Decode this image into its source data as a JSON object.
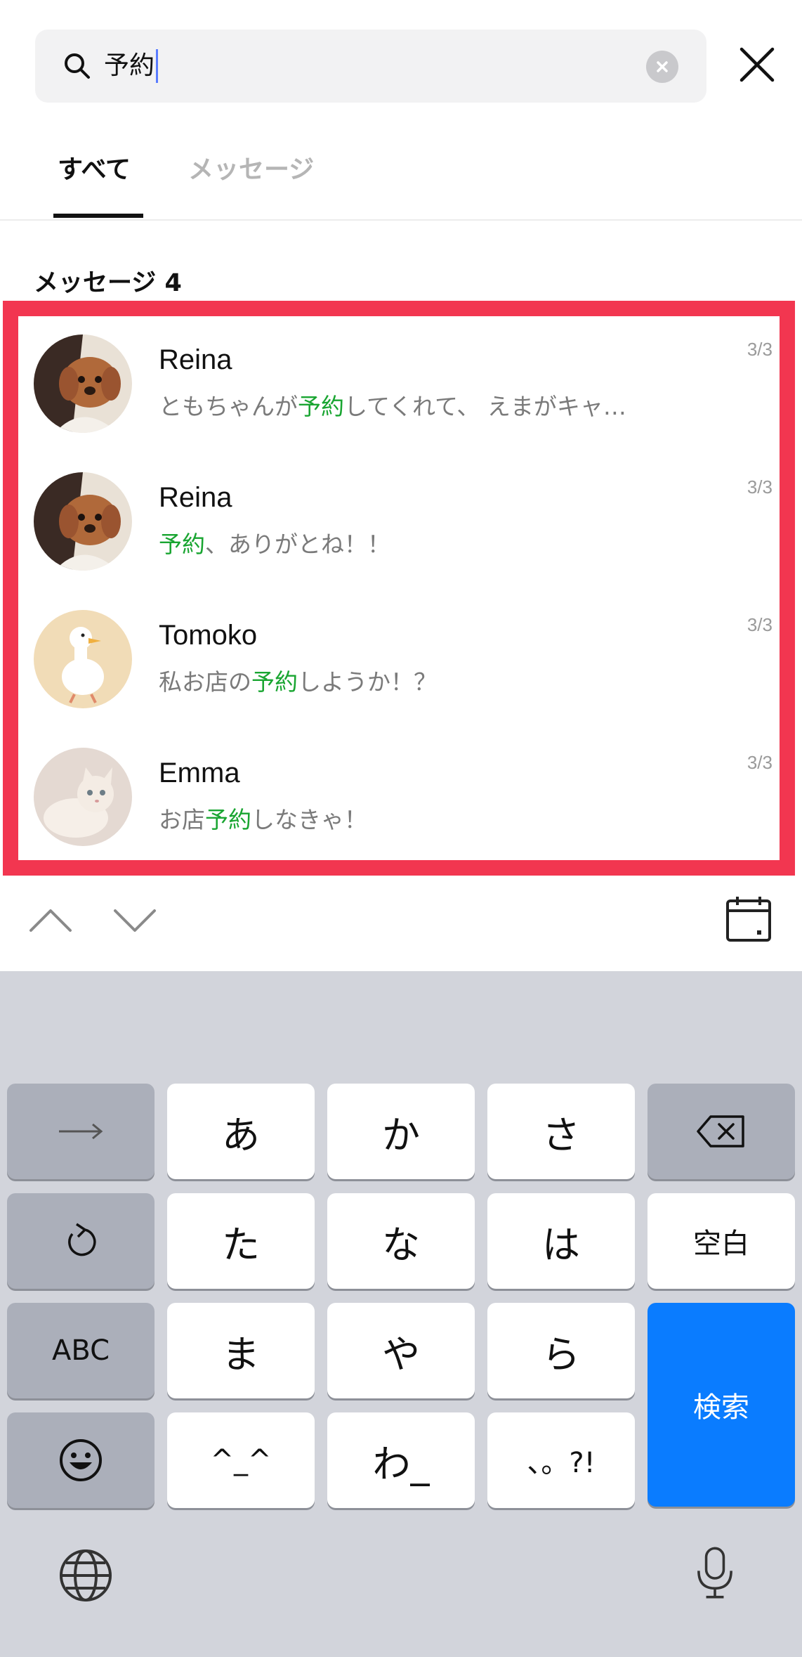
{
  "search": {
    "query": "予約",
    "clear_icon": "clear-circle-icon",
    "close_icon": "close-icon"
  },
  "tabs": [
    {
      "label": "すべて",
      "active": true
    },
    {
      "label": "メッセージ",
      "active": false
    }
  ],
  "section": {
    "title": "メッセージ 4"
  },
  "highlight_color": "#19a531",
  "results": [
    {
      "name": "Reina",
      "date": "3/3",
      "pre": "ともちゃんが",
      "hl": "予約",
      "post": "してくれて、 えまがキャ…",
      "avatar": "dog-avatar"
    },
    {
      "name": "Reina",
      "date": "3/3",
      "pre": "",
      "hl": "予約",
      "post": "、ありがとね！！",
      "avatar": "dog-avatar"
    },
    {
      "name": "Tomoko",
      "date": "3/3",
      "pre": "私お店の",
      "hl": "予約",
      "post": "しようか！？",
      "avatar": "duck-avatar"
    },
    {
      "name": "Emma",
      "date": "3/3",
      "pre": "お店",
      "hl": "予約",
      "post": "しなきゃ！",
      "avatar": "cat-avatar"
    }
  ],
  "nav": {
    "up_icon": "chevron-up-icon",
    "down_icon": "chevron-down-icon",
    "calendar_icon": "calendar-icon"
  },
  "keyboard": {
    "row1": [
      "→",
      "あ",
      "か",
      "さ"
    ],
    "row2": [
      "た",
      "な",
      "は",
      "空白"
    ],
    "row3": [
      "ABC",
      "ま",
      "や",
      "ら"
    ],
    "row4": [
      "^_^",
      "わ_",
      "、。?!"
    ],
    "search_key": "検索",
    "accent_color": "#0a7cff"
  }
}
